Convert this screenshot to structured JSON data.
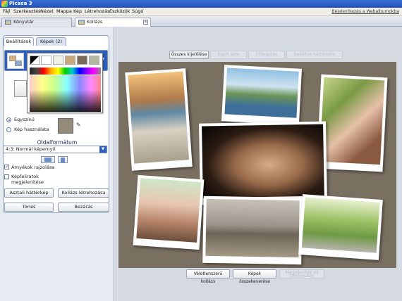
{
  "window": {
    "title": "Picasa 3"
  },
  "menu": {
    "items": [
      "Fájl",
      "Szerkesztés",
      "Nézet",
      "Mappa",
      "Kép",
      "Létrehozás",
      "Eszközök",
      "Súgó"
    ],
    "signin": "Bejelentkezés a Webalbumokba"
  },
  "tabs": {
    "library": "Könyvtár",
    "collage": "Kollázs",
    "close": "x"
  },
  "panel": {
    "tab_settings": "Beállítások",
    "tab_images": "Képek (2)",
    "radio_solid": "Egyszínű",
    "radio_image": "Kép használata",
    "format_title": "Oldalformátum",
    "format_value": "4:3: Normál képernyő",
    "shadow_label": "Árnyékok rajzolása",
    "captions_label": "Képfeliratok megjelenítése",
    "btn_desktop": "Asztali háttérkép",
    "btn_create": "Kollázs létrehozása",
    "btn_delete": "Törlés",
    "btn_close": "Bezárás"
  },
  "colors": {
    "accent": "#2d5fbf",
    "background_swatch": "#938a7a",
    "collage_bg": "#7a7062",
    "picker_swatches": [
      "#000000",
      "#ffffff",
      "#f2efe6",
      "#c9a97b",
      "#7b6a55",
      "#938a7a",
      "#b2b7a0"
    ]
  },
  "canvas": {
    "top_buttons": [
      "Összes kijelölése",
      "Egyik sem",
      "Elforgatás",
      "Beállítás háttérként"
    ],
    "bottom_buttons": [
      "Véletlenszerű kollázs",
      "Képek összekeverése",
      "Megjelenítés és szerkesztés"
    ]
  }
}
